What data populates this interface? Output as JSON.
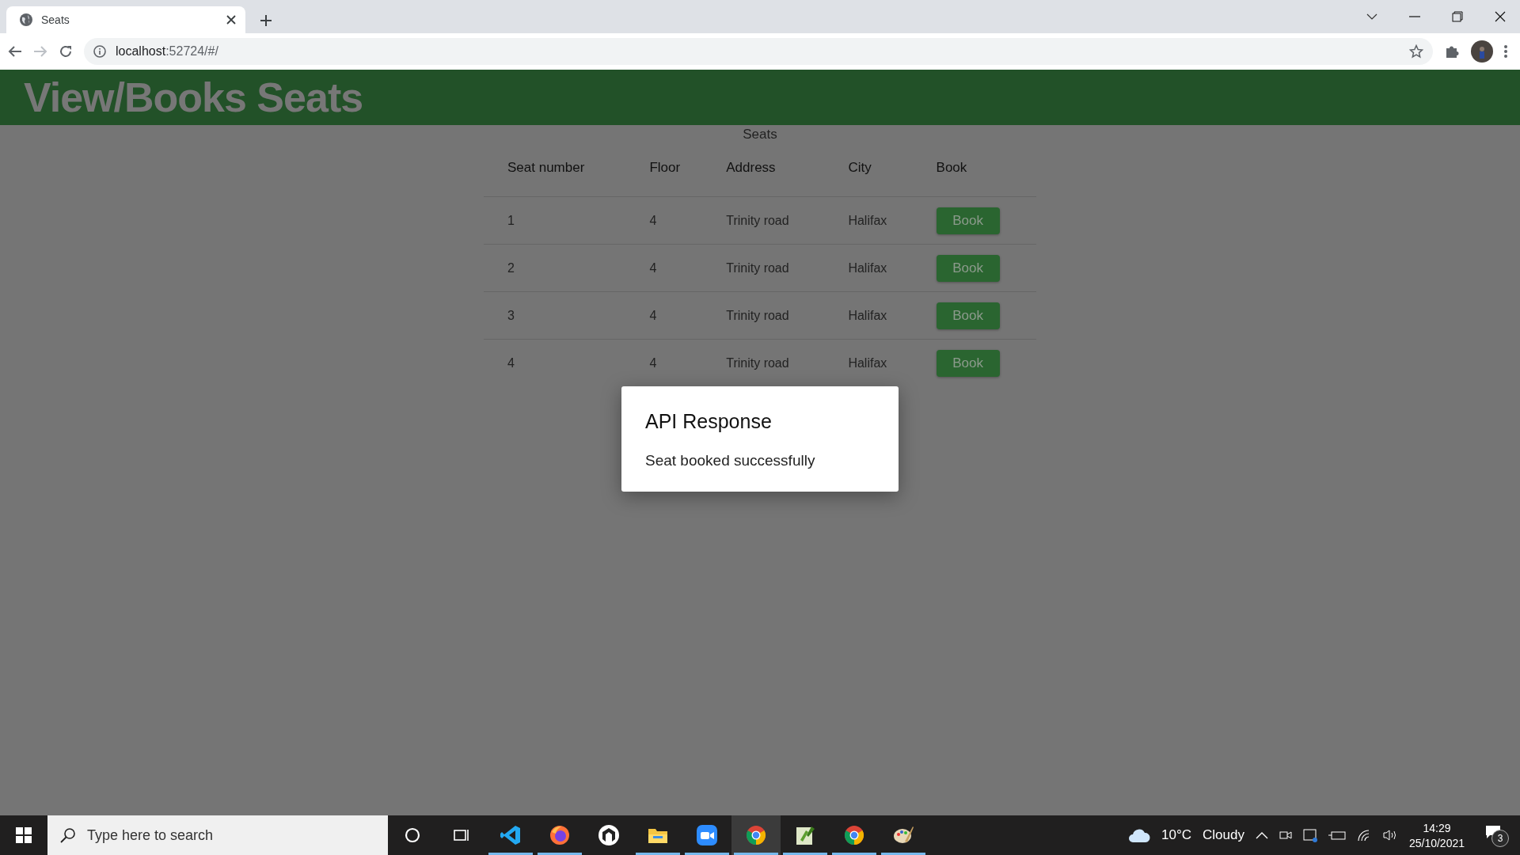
{
  "browser": {
    "tab": {
      "title": "Seats",
      "selected": true
    },
    "url_host": "localhost",
    "url_rest": ":52724/#/",
    "back_disabled": false,
    "forward_disabled": true
  },
  "header": {
    "title": "View/Books Seats"
  },
  "table": {
    "caption": "Seats",
    "columns": [
      "Seat number",
      "Floor",
      "Address",
      "City",
      "Book"
    ],
    "rows": [
      {
        "seat": "1",
        "floor": "4",
        "address": "Trinity road",
        "city": "Halifax",
        "action": "Book"
      },
      {
        "seat": "2",
        "floor": "4",
        "address": "Trinity road",
        "city": "Halifax",
        "action": "Book"
      },
      {
        "seat": "3",
        "floor": "4",
        "address": "Trinity road",
        "city": "Halifax",
        "action": "Book"
      },
      {
        "seat": "4",
        "floor": "4",
        "address": "Trinity road",
        "city": "Halifax",
        "action": "Book"
      }
    ]
  },
  "dialog": {
    "title": "API Response",
    "message": "Seat booked successfully"
  },
  "taskbar": {
    "search_placeholder": "Type here to search",
    "apps": [
      {
        "kind": "cortana",
        "running": false,
        "active": false
      },
      {
        "kind": "taskview",
        "running": false,
        "active": false
      },
      {
        "kind": "code",
        "running": true,
        "active": false
      },
      {
        "kind": "firefox",
        "running": true,
        "active": false
      },
      {
        "kind": "hexagon",
        "running": false,
        "active": false
      },
      {
        "kind": "folder",
        "running": true,
        "active": false
      },
      {
        "kind": "camera",
        "running": true,
        "active": false
      },
      {
        "kind": "chrome",
        "running": true,
        "active": true
      },
      {
        "kind": "notepad",
        "running": true,
        "active": false
      },
      {
        "kind": "chrome",
        "running": true,
        "active": false
      },
      {
        "kind": "paint",
        "running": true,
        "active": false
      }
    ],
    "temperature": "10°C",
    "weather": "Cloudy",
    "time": "14:29",
    "date": "25/10/2021",
    "notifications": "3"
  }
}
